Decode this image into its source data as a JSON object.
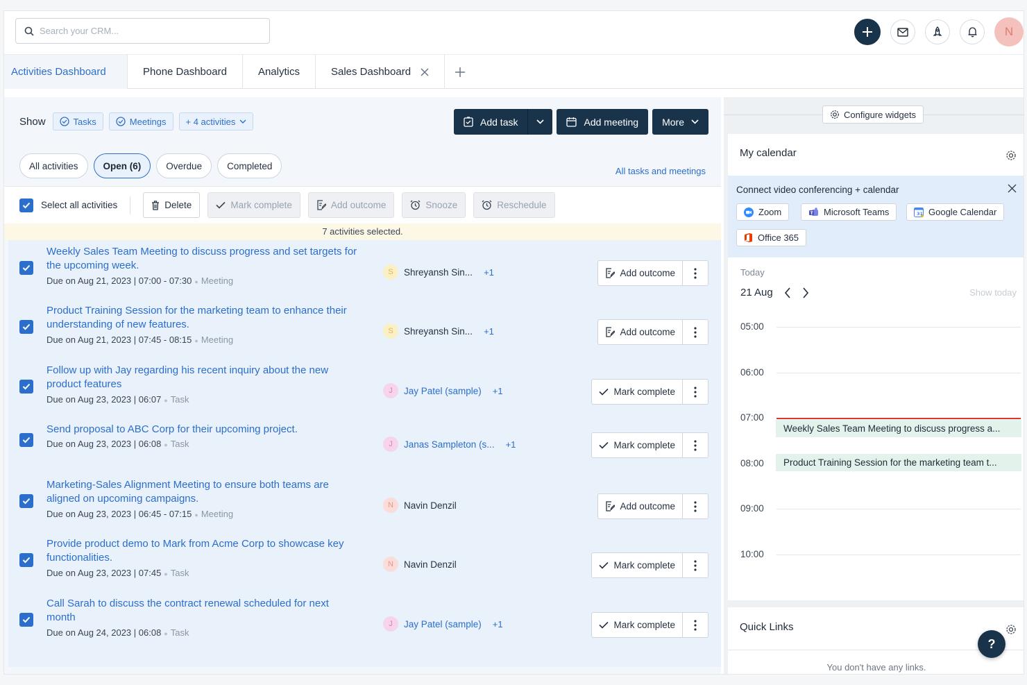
{
  "topbar": {
    "search_placeholder": "Search your CRM...",
    "avatar_initial": "N"
  },
  "tabs": [
    {
      "label": "Activities Dashboard",
      "active": true
    },
    {
      "label": "Phone Dashboard"
    },
    {
      "label": "Analytics"
    },
    {
      "label": "Sales Dashboard",
      "closable": true
    }
  ],
  "toolbar": {
    "show_label": "Show",
    "chips": [
      "Tasks",
      "Meetings",
      "+ 4 activities"
    ],
    "add_task": "Add task",
    "add_meeting": "Add meeting",
    "more": "More"
  },
  "filters": {
    "pills": [
      "All activities",
      "Open (6)",
      "Overdue",
      "Completed"
    ],
    "active_pill": "Open (6)",
    "all_link": "All tasks and meetings"
  },
  "bulk": {
    "select_all": "Select all activities",
    "delete": "Delete",
    "mark_complete": "Mark complete",
    "add_outcome": "Add outcome",
    "snooze": "Snooze",
    "reschedule": "Reschedule",
    "selected_text": "7 activities selected."
  },
  "activities": [
    {
      "title": "Weekly Sales Team Meeting to discuss progress and set targets for the upcoming week.",
      "due": "Due on Aug 21, 2023 | 07:00 - 07:30",
      "kind": "Meeting",
      "owner_initial": "S",
      "owner": "Shreyansh Sin...",
      "extra": "+1",
      "action": "Add outcome"
    },
    {
      "title": "Product Training Session for the marketing team to enhance their understanding of new features.",
      "due": "Due on Aug 21, 2023 | 07:45 - 08:15",
      "kind": "Meeting",
      "owner_initial": "S",
      "owner": "Shreyansh Sin...",
      "extra": "+1",
      "action": "Add outcome"
    },
    {
      "title": "Follow up with Jay regarding his recent inquiry about the new product features",
      "due": "Due on Aug 23, 2023 | 06:07",
      "kind": "Task",
      "owner_initial": "J",
      "owner": "Jay Patel (sample)",
      "extra": "+1",
      "action": "Mark complete"
    },
    {
      "title": "Send proposal to ABC Corp for their upcoming project.",
      "due": "Due on Aug 23, 2023 | 06:08",
      "kind": "Task",
      "owner_initial": "J",
      "owner": "Janas Sampleton (s...",
      "extra": "+1",
      "action": "Mark complete"
    },
    {
      "title": "Marketing-Sales Alignment Meeting to ensure both teams are aligned on upcoming campaigns.",
      "due": "Due on Aug 23, 2023 | 06:45 - 07:15",
      "kind": "Meeting",
      "owner_initial": "N",
      "owner": "Navin Denzil",
      "extra": "",
      "action": "Add outcome"
    },
    {
      "title": "Provide product demo to Mark from Acme Corp to showcase key functionalities.",
      "due": "Due on Aug 23, 2023 | 07:45",
      "kind": "Task",
      "owner_initial": "N",
      "owner": "Navin Denzil",
      "extra": "",
      "action": "Mark complete"
    },
    {
      "title": "Call Sarah to discuss the contract renewal scheduled for next month",
      "due": "Due on Aug 24, 2023 | 06:08",
      "kind": "Task",
      "owner_initial": "J",
      "owner": "Jay Patel (sample)",
      "extra": "+1",
      "action": "Mark complete"
    }
  ],
  "widgets": {
    "configure": "Configure widgets",
    "calendar": {
      "title": "My calendar",
      "connect_title": "Connect video conferencing + calendar",
      "integrations": [
        "Zoom",
        "Microsoft Teams",
        "Google Calendar",
        "Office 365"
      ],
      "today_label": "Today",
      "date": "21 Aug",
      "show_today": "Show today",
      "hours": [
        "05:00",
        "06:00",
        "07:00",
        "08:00",
        "09:00",
        "10:00"
      ],
      "events": [
        "Weekly Sales Team Meeting to discuss progress a...",
        "Product Training Session for the marketing team t..."
      ]
    },
    "quick_links": {
      "title": "Quick Links",
      "empty": "You don't have any links."
    },
    "help": "?"
  },
  "colors": {
    "primary_dark": "#19334a",
    "link_blue": "#2c6ecb",
    "row_bg": "#e9f1fb",
    "event_bg": "#e3f3ec",
    "now_line": "#dd3333"
  }
}
